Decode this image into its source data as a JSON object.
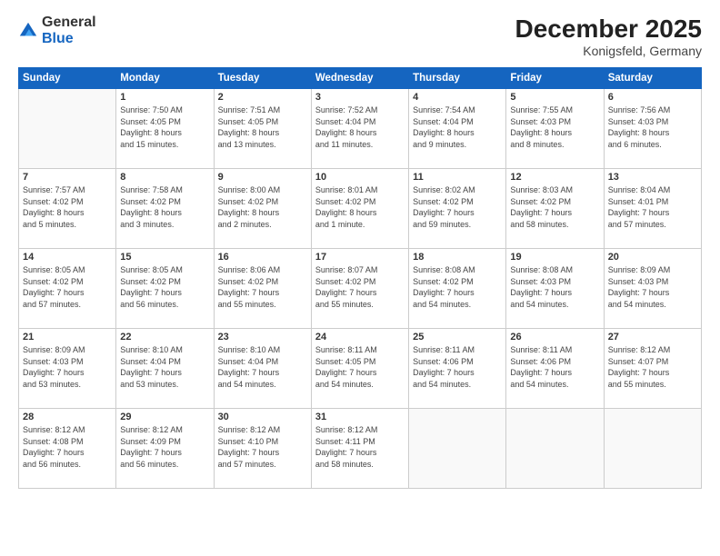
{
  "logo": {
    "general": "General",
    "blue": "Blue"
  },
  "header": {
    "month": "December 2025",
    "location": "Konigsfeld, Germany"
  },
  "weekdays": [
    "Sunday",
    "Monday",
    "Tuesday",
    "Wednesday",
    "Thursday",
    "Friday",
    "Saturday"
  ],
  "weeks": [
    [
      {
        "day": "",
        "info": ""
      },
      {
        "day": "1",
        "info": "Sunrise: 7:50 AM\nSunset: 4:05 PM\nDaylight: 8 hours\nand 15 minutes."
      },
      {
        "day": "2",
        "info": "Sunrise: 7:51 AM\nSunset: 4:05 PM\nDaylight: 8 hours\nand 13 minutes."
      },
      {
        "day": "3",
        "info": "Sunrise: 7:52 AM\nSunset: 4:04 PM\nDaylight: 8 hours\nand 11 minutes."
      },
      {
        "day": "4",
        "info": "Sunrise: 7:54 AM\nSunset: 4:04 PM\nDaylight: 8 hours\nand 9 minutes."
      },
      {
        "day": "5",
        "info": "Sunrise: 7:55 AM\nSunset: 4:03 PM\nDaylight: 8 hours\nand 8 minutes."
      },
      {
        "day": "6",
        "info": "Sunrise: 7:56 AM\nSunset: 4:03 PM\nDaylight: 8 hours\nand 6 minutes."
      }
    ],
    [
      {
        "day": "7",
        "info": "Sunrise: 7:57 AM\nSunset: 4:02 PM\nDaylight: 8 hours\nand 5 minutes."
      },
      {
        "day": "8",
        "info": "Sunrise: 7:58 AM\nSunset: 4:02 PM\nDaylight: 8 hours\nand 3 minutes."
      },
      {
        "day": "9",
        "info": "Sunrise: 8:00 AM\nSunset: 4:02 PM\nDaylight: 8 hours\nand 2 minutes."
      },
      {
        "day": "10",
        "info": "Sunrise: 8:01 AM\nSunset: 4:02 PM\nDaylight: 8 hours\nand 1 minute."
      },
      {
        "day": "11",
        "info": "Sunrise: 8:02 AM\nSunset: 4:02 PM\nDaylight: 7 hours\nand 59 minutes."
      },
      {
        "day": "12",
        "info": "Sunrise: 8:03 AM\nSunset: 4:02 PM\nDaylight: 7 hours\nand 58 minutes."
      },
      {
        "day": "13",
        "info": "Sunrise: 8:04 AM\nSunset: 4:01 PM\nDaylight: 7 hours\nand 57 minutes."
      }
    ],
    [
      {
        "day": "14",
        "info": "Sunrise: 8:05 AM\nSunset: 4:02 PM\nDaylight: 7 hours\nand 57 minutes."
      },
      {
        "day": "15",
        "info": "Sunrise: 8:05 AM\nSunset: 4:02 PM\nDaylight: 7 hours\nand 56 minutes."
      },
      {
        "day": "16",
        "info": "Sunrise: 8:06 AM\nSunset: 4:02 PM\nDaylight: 7 hours\nand 55 minutes."
      },
      {
        "day": "17",
        "info": "Sunrise: 8:07 AM\nSunset: 4:02 PM\nDaylight: 7 hours\nand 55 minutes."
      },
      {
        "day": "18",
        "info": "Sunrise: 8:08 AM\nSunset: 4:02 PM\nDaylight: 7 hours\nand 54 minutes."
      },
      {
        "day": "19",
        "info": "Sunrise: 8:08 AM\nSunset: 4:03 PM\nDaylight: 7 hours\nand 54 minutes."
      },
      {
        "day": "20",
        "info": "Sunrise: 8:09 AM\nSunset: 4:03 PM\nDaylight: 7 hours\nand 54 minutes."
      }
    ],
    [
      {
        "day": "21",
        "info": "Sunrise: 8:09 AM\nSunset: 4:03 PM\nDaylight: 7 hours\nand 53 minutes."
      },
      {
        "day": "22",
        "info": "Sunrise: 8:10 AM\nSunset: 4:04 PM\nDaylight: 7 hours\nand 53 minutes."
      },
      {
        "day": "23",
        "info": "Sunrise: 8:10 AM\nSunset: 4:04 PM\nDaylight: 7 hours\nand 54 minutes."
      },
      {
        "day": "24",
        "info": "Sunrise: 8:11 AM\nSunset: 4:05 PM\nDaylight: 7 hours\nand 54 minutes."
      },
      {
        "day": "25",
        "info": "Sunrise: 8:11 AM\nSunset: 4:06 PM\nDaylight: 7 hours\nand 54 minutes."
      },
      {
        "day": "26",
        "info": "Sunrise: 8:11 AM\nSunset: 4:06 PM\nDaylight: 7 hours\nand 54 minutes."
      },
      {
        "day": "27",
        "info": "Sunrise: 8:12 AM\nSunset: 4:07 PM\nDaylight: 7 hours\nand 55 minutes."
      }
    ],
    [
      {
        "day": "28",
        "info": "Sunrise: 8:12 AM\nSunset: 4:08 PM\nDaylight: 7 hours\nand 56 minutes."
      },
      {
        "day": "29",
        "info": "Sunrise: 8:12 AM\nSunset: 4:09 PM\nDaylight: 7 hours\nand 56 minutes."
      },
      {
        "day": "30",
        "info": "Sunrise: 8:12 AM\nSunset: 4:10 PM\nDaylight: 7 hours\nand 57 minutes."
      },
      {
        "day": "31",
        "info": "Sunrise: 8:12 AM\nSunset: 4:11 PM\nDaylight: 7 hours\nand 58 minutes."
      },
      {
        "day": "",
        "info": ""
      },
      {
        "day": "",
        "info": ""
      },
      {
        "day": "",
        "info": ""
      }
    ]
  ]
}
